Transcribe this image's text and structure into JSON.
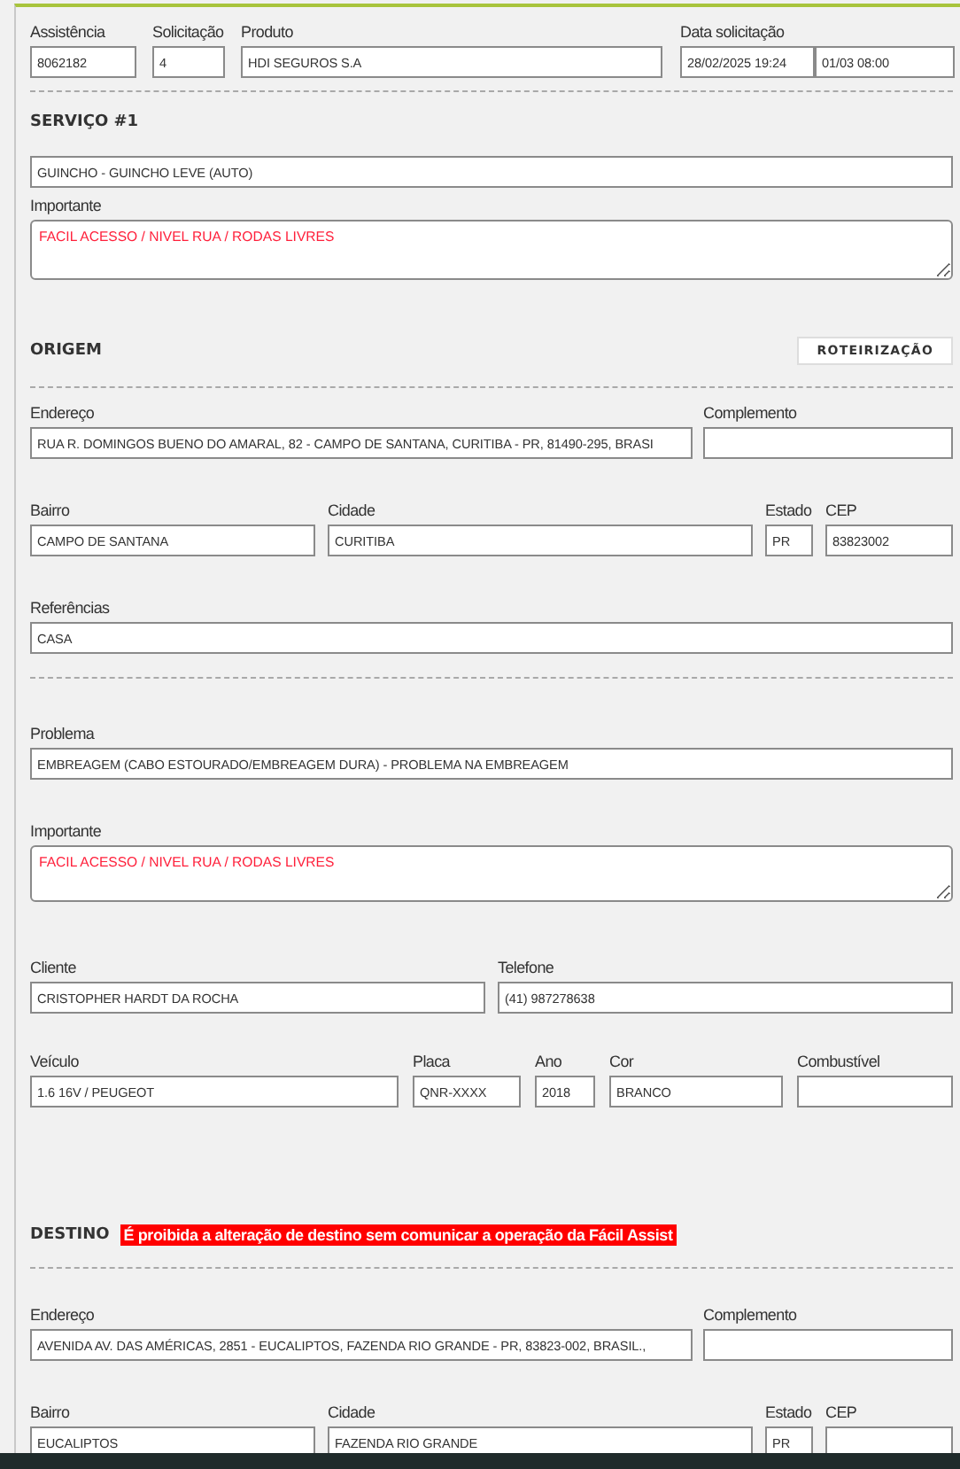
{
  "header": [
    {
      "label": "Assistência",
      "value": "8062182"
    },
    {
      "label": "Solicitação",
      "value": "4"
    },
    {
      "label": "Produto",
      "value": "HDI SEGUROS S.A"
    },
    {
      "label": "Data solicitação",
      "value": "28/02/2025 19:24"
    },
    {
      "value": "01/03 08:00"
    }
  ],
  "sections": [
    {
      "title": "SERVIÇO #1",
      "rows": [
        {
          "kind": "fields",
          "fields": [
            {
              "kind": "input",
              "value": "GUINCHO - GUINCHO LEVE (AUTO)"
            }
          ]
        },
        {
          "kind": "fields",
          "fields": [
            {
              "kind": "textarea",
              "label": "Importante",
              "value": "FACIL ACESSO / NIVEL RUA / RODAS LIVRES"
            }
          ]
        }
      ]
    },
    {
      "title": "ORIGEM",
      "button": "ROTEIRIZAÇÃO",
      "rows": [
        {
          "kind": "divider"
        },
        {
          "kind": "fields",
          "fields": [
            {
              "kind": "input",
              "label": "Endereço",
              "value": "RUA R. DOMINGOS BUENO DO AMARAL, 82 - CAMPO DE SANTANA, CURITIBA - PR, 81490-295, BRASI"
            },
            {
              "kind": "input",
              "label": "Complemento"
            }
          ]
        },
        {
          "kind": "fields",
          "fields": [
            {
              "kind": "input",
              "label": "Bairro",
              "value": "CAMPO DE SANTANA"
            },
            {
              "kind": "input",
              "label": "Cidade",
              "value": "CURITIBA"
            },
            {
              "kind": "input",
              "label": "Estado",
              "value": "PR"
            },
            {
              "kind": "input",
              "label": "CEP",
              "value": "83823002"
            }
          ]
        },
        {
          "kind": "fields",
          "fields": [
            {
              "kind": "input",
              "label": "Referências",
              "value": "CASA"
            }
          ]
        },
        {
          "kind": "divider"
        },
        {
          "kind": "fields",
          "fields": [
            {
              "kind": "input",
              "label": "Problema",
              "value": "EMBREAGEM (CABO ESTOURADO/EMBREAGEM DURA) - PROBLEMA NA EMBREAGEM"
            }
          ]
        },
        {
          "kind": "fields",
          "fields": [
            {
              "kind": "textarea",
              "label": "Importante",
              "value": "FACIL ACESSO / NIVEL RUA / RODAS LIVRES"
            }
          ]
        },
        {
          "kind": "fields",
          "fields": [
            {
              "kind": "input",
              "label": "Cliente",
              "value": "CRISTOPHER HARDT DA ROCHA"
            },
            {
              "kind": "input",
              "label": "Telefone",
              "value": "(41) 987278638"
            }
          ]
        },
        {
          "kind": "fields",
          "fields": [
            {
              "kind": "input",
              "label": "Veículo",
              "value": "1.6 16V / PEUGEOT"
            },
            {
              "kind": "input",
              "label": "Placa",
              "value": "QNR-XXXX"
            },
            {
              "kind": "input",
              "label": "Ano",
              "value": "2018"
            },
            {
              "kind": "input",
              "label": "Cor",
              "value": "BRANCO"
            },
            {
              "kind": "input",
              "label": "Combustível"
            }
          ]
        }
      ]
    },
    {
      "title": "DESTINO",
      "notice": "É proibida a alteração de destino sem comunicar a operação da Fácil Assist",
      "rows": [
        {
          "kind": "divider"
        },
        {
          "kind": "fields",
          "fields": [
            {
              "kind": "input",
              "label": "Endereço",
              "value": "AVENIDA AV. DAS AMÉRICAS, 2851 - EUCALIPTOS, FAZENDA RIO GRANDE - PR, 83823-002, BRASIL.,"
            },
            {
              "kind": "input",
              "label": "Complemento"
            }
          ]
        },
        {
          "kind": "fields",
          "fields": [
            {
              "kind": "input",
              "label": "Bairro",
              "value": "EUCALIPTOS"
            },
            {
              "kind": "input",
              "label": "Cidade",
              "value": "FAZENDA RIO GRANDE"
            },
            {
              "kind": "input",
              "label": "Estado",
              "value": "PR"
            },
            {
              "kind": "input",
              "label": "CEP"
            }
          ]
        }
      ]
    }
  ]
}
